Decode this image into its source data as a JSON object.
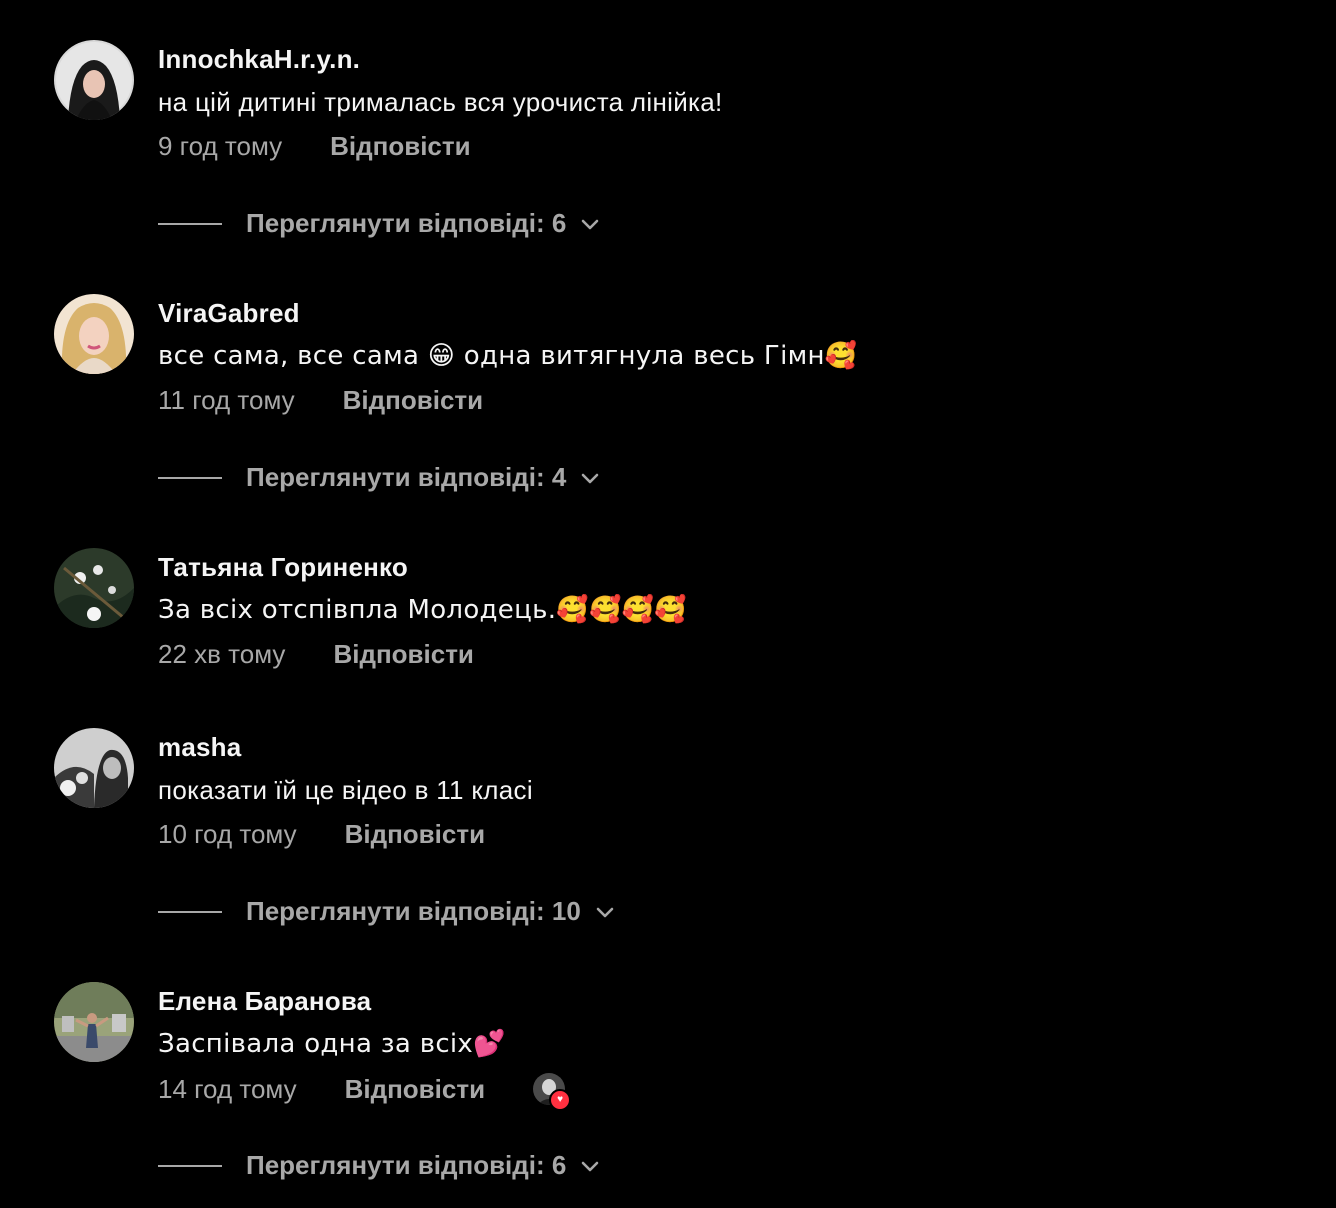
{
  "colors": {
    "background": "#000000",
    "primary_text": "#f5f5f5",
    "secondary_text": "#a8a8a8",
    "like_heart": "#ff3040"
  },
  "comments": [
    {
      "username": "InnochkaH.r.y.n.",
      "text": "на цій дитині трималась вся урочиста лінійка!",
      "time": "9 год тому",
      "reply_label": "Відповісти",
      "view_replies": "Переглянути відповіді: 6"
    },
    {
      "username": "ViraGabred",
      "text": "все сама, все сама 😁 одна витягнула весь Гімн🥰",
      "time": "11 год тому",
      "reply_label": "Відповісти",
      "view_replies": "Переглянути відповіді: 4"
    },
    {
      "username": "Татьяна Гориненко",
      "text": "За всіх отспівпла Молодець.🥰🥰🥰🥰",
      "time": "22 хв тому",
      "reply_label": "Відповісти"
    },
    {
      "username": "masha",
      "text": "показати їй це відео в 11 класі",
      "time": "10 год тому",
      "reply_label": "Відповісти",
      "view_replies": "Переглянути відповіді: 10"
    },
    {
      "username": "Елена Баранова",
      "text": "Заспівала одна за всіх💕",
      "time": "14 год тому",
      "reply_label": "Відповісти",
      "liked_by_author_icon": "heart-icon",
      "view_replies": "Переглянути відповіді: 6"
    }
  ]
}
